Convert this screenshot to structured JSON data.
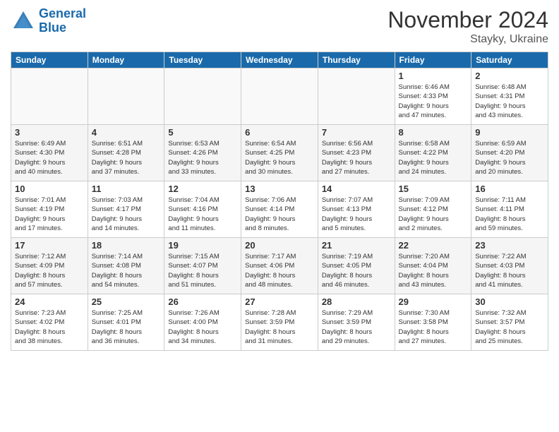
{
  "logo": {
    "line1": "General",
    "line2": "Blue"
  },
  "title": "November 2024",
  "location": "Stayky, Ukraine",
  "days_of_week": [
    "Sunday",
    "Monday",
    "Tuesday",
    "Wednesday",
    "Thursday",
    "Friday",
    "Saturday"
  ],
  "weeks": [
    {
      "days": [
        {
          "date": "",
          "info": ""
        },
        {
          "date": "",
          "info": ""
        },
        {
          "date": "",
          "info": ""
        },
        {
          "date": "",
          "info": ""
        },
        {
          "date": "",
          "info": ""
        },
        {
          "date": "1",
          "info": "Sunrise: 6:46 AM\nSunset: 4:33 PM\nDaylight: 9 hours\nand 47 minutes."
        },
        {
          "date": "2",
          "info": "Sunrise: 6:48 AM\nSunset: 4:31 PM\nDaylight: 9 hours\nand 43 minutes."
        }
      ]
    },
    {
      "days": [
        {
          "date": "3",
          "info": "Sunrise: 6:49 AM\nSunset: 4:30 PM\nDaylight: 9 hours\nand 40 minutes."
        },
        {
          "date": "4",
          "info": "Sunrise: 6:51 AM\nSunset: 4:28 PM\nDaylight: 9 hours\nand 37 minutes."
        },
        {
          "date": "5",
          "info": "Sunrise: 6:53 AM\nSunset: 4:26 PM\nDaylight: 9 hours\nand 33 minutes."
        },
        {
          "date": "6",
          "info": "Sunrise: 6:54 AM\nSunset: 4:25 PM\nDaylight: 9 hours\nand 30 minutes."
        },
        {
          "date": "7",
          "info": "Sunrise: 6:56 AM\nSunset: 4:23 PM\nDaylight: 9 hours\nand 27 minutes."
        },
        {
          "date": "8",
          "info": "Sunrise: 6:58 AM\nSunset: 4:22 PM\nDaylight: 9 hours\nand 24 minutes."
        },
        {
          "date": "9",
          "info": "Sunrise: 6:59 AM\nSunset: 4:20 PM\nDaylight: 9 hours\nand 20 minutes."
        }
      ]
    },
    {
      "days": [
        {
          "date": "10",
          "info": "Sunrise: 7:01 AM\nSunset: 4:19 PM\nDaylight: 9 hours\nand 17 minutes."
        },
        {
          "date": "11",
          "info": "Sunrise: 7:03 AM\nSunset: 4:17 PM\nDaylight: 9 hours\nand 14 minutes."
        },
        {
          "date": "12",
          "info": "Sunrise: 7:04 AM\nSunset: 4:16 PM\nDaylight: 9 hours\nand 11 minutes."
        },
        {
          "date": "13",
          "info": "Sunrise: 7:06 AM\nSunset: 4:14 PM\nDaylight: 9 hours\nand 8 minutes."
        },
        {
          "date": "14",
          "info": "Sunrise: 7:07 AM\nSunset: 4:13 PM\nDaylight: 9 hours\nand 5 minutes."
        },
        {
          "date": "15",
          "info": "Sunrise: 7:09 AM\nSunset: 4:12 PM\nDaylight: 9 hours\nand 2 minutes."
        },
        {
          "date": "16",
          "info": "Sunrise: 7:11 AM\nSunset: 4:11 PM\nDaylight: 8 hours\nand 59 minutes."
        }
      ]
    },
    {
      "days": [
        {
          "date": "17",
          "info": "Sunrise: 7:12 AM\nSunset: 4:09 PM\nDaylight: 8 hours\nand 57 minutes."
        },
        {
          "date": "18",
          "info": "Sunrise: 7:14 AM\nSunset: 4:08 PM\nDaylight: 8 hours\nand 54 minutes."
        },
        {
          "date": "19",
          "info": "Sunrise: 7:15 AM\nSunset: 4:07 PM\nDaylight: 8 hours\nand 51 minutes."
        },
        {
          "date": "20",
          "info": "Sunrise: 7:17 AM\nSunset: 4:06 PM\nDaylight: 8 hours\nand 48 minutes."
        },
        {
          "date": "21",
          "info": "Sunrise: 7:19 AM\nSunset: 4:05 PM\nDaylight: 8 hours\nand 46 minutes."
        },
        {
          "date": "22",
          "info": "Sunrise: 7:20 AM\nSunset: 4:04 PM\nDaylight: 8 hours\nand 43 minutes."
        },
        {
          "date": "23",
          "info": "Sunrise: 7:22 AM\nSunset: 4:03 PM\nDaylight: 8 hours\nand 41 minutes."
        }
      ]
    },
    {
      "days": [
        {
          "date": "24",
          "info": "Sunrise: 7:23 AM\nSunset: 4:02 PM\nDaylight: 8 hours\nand 38 minutes."
        },
        {
          "date": "25",
          "info": "Sunrise: 7:25 AM\nSunset: 4:01 PM\nDaylight: 8 hours\nand 36 minutes."
        },
        {
          "date": "26",
          "info": "Sunrise: 7:26 AM\nSunset: 4:00 PM\nDaylight: 8 hours\nand 34 minutes."
        },
        {
          "date": "27",
          "info": "Sunrise: 7:28 AM\nSunset: 3:59 PM\nDaylight: 8 hours\nand 31 minutes."
        },
        {
          "date": "28",
          "info": "Sunrise: 7:29 AM\nSunset: 3:59 PM\nDaylight: 8 hours\nand 29 minutes."
        },
        {
          "date": "29",
          "info": "Sunrise: 7:30 AM\nSunset: 3:58 PM\nDaylight: 8 hours\nand 27 minutes."
        },
        {
          "date": "30",
          "info": "Sunrise: 7:32 AM\nSunset: 3:57 PM\nDaylight: 8 hours\nand 25 minutes."
        }
      ]
    }
  ]
}
